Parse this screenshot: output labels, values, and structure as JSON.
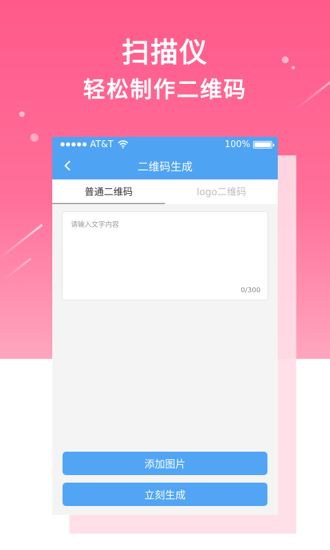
{
  "headline": {
    "title": "扫描仪",
    "subtitle": "轻松制作二维码"
  },
  "statusbar": {
    "carrier": "AT&T",
    "battery": "100%",
    "icons": [
      "signal-dots-icon",
      "wifi-icon",
      "battery-icon"
    ]
  },
  "navbar": {
    "title": "二维码生成",
    "back_icon": "chevron-left-icon"
  },
  "tabs": [
    {
      "label": "普通二维码",
      "active": true
    },
    {
      "label": "logo二维码",
      "active": false
    }
  ],
  "text_input": {
    "value": "",
    "placeholder": "请输入文字内容",
    "counter": "0/300"
  },
  "buttons": {
    "add_image": "添加图片",
    "generate": "立刻生成"
  },
  "colors": {
    "brand_blue": "#4fa3f3",
    "button_blue": "#51a5f4",
    "pink": "#ff5a8a"
  }
}
